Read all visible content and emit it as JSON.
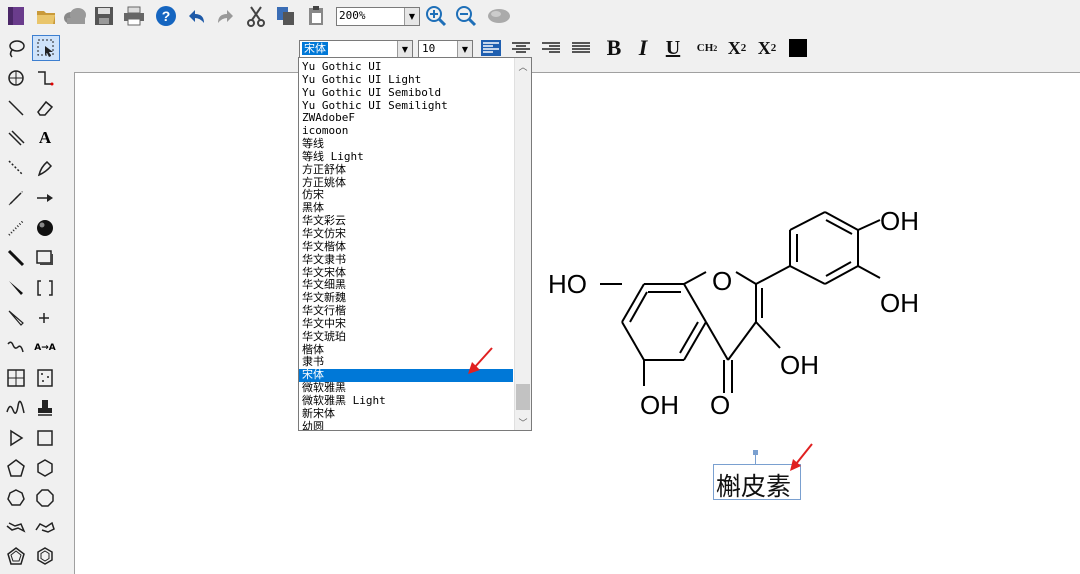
{
  "toolbar": {
    "zoom_value": "200%",
    "font_value": "宋体",
    "size_value": "10",
    "bold_label": "B",
    "italic_label": "I",
    "underline_label": "U",
    "ch2_label": "CH",
    "ch2_sub": "2",
    "sub_label": "X",
    "sub_sub": "2",
    "sup_label": "X",
    "sup_sup": "2",
    "text_tool_label": "A",
    "arrow_tool_label": "A→A"
  },
  "font_list": [
    "Yu Gothic UI",
    "Yu Gothic UI Light",
    "Yu Gothic UI Semibold",
    "Yu Gothic UI Semilight",
    "ZWAdobeF",
    "icomoon",
    "等线",
    "等线 Light",
    "方正舒体",
    "方正姚体",
    "仿宋",
    "黑体",
    "华文彩云",
    "华文仿宋",
    "华文楷体",
    "华文隶书",
    "华文宋体",
    "华文细黑",
    "华文新魏",
    "华文行楷",
    "华文中宋",
    "华文琥珀",
    "楷体",
    "隶书",
    "宋体",
    "微软雅黑",
    "微软雅黑 Light",
    "新宋体",
    "幼圆"
  ],
  "selected_font_index": 24,
  "structure": {
    "oh_left": "HO",
    "oh_top_right_1": "OH",
    "oh_top_right_2": "OH",
    "oh_right": "OH",
    "oh_bottom": "OH",
    "ring_o": "O",
    "carbonyl_o": "O"
  },
  "label_text": "槲皮素",
  "colors": {
    "accent": "#0078d7",
    "annotation": "#e02020"
  }
}
